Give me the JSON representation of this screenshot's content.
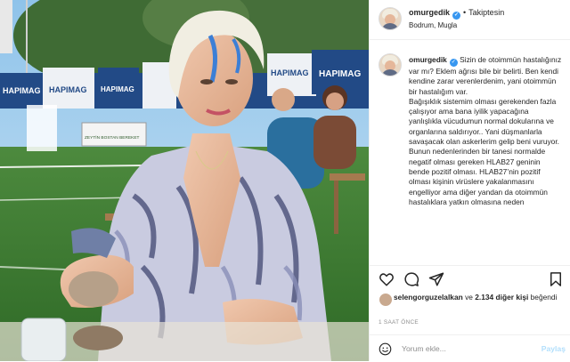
{
  "post": {
    "username": "omurgedik",
    "follow_label": "Takiptesin",
    "location": "Bodrum, Mugla",
    "caption": "Sizin de otoimmün hastalığınız var mı? Eklem ağrısı bile bir belirti. Ben kendi kendine zarar verenlerdenim, yani otoimmün bir hastalığım var.\nBağışıklık sistemim olması gerekenden fazla çalışıyor ama bana iyilik yapacağına yanlışlıkla vücudumun normal dokularına ve organlarına saldırıyor.. Yani düşmanlarla savaşacak olan askerlerim gelip beni vuruyor. Bunun nedenlerinden bir tanesi normalde negatif olması gereken HLAB27 geninin bende pozitif olması. HLAB27’nin pozitif olması kişinin virüslere yakalanmasını engelliyor ama diğer yandan da otoimmün hastalıklara yatkın olmasına neden",
    "liked_by_user": "selengorguzelalkan",
    "liked_joiner": "ve",
    "likes_count": "2.134 diğer kişi",
    "liked_suffix": "beğendi",
    "time_ago": "1 SAAT ÖNCE"
  },
  "photo": {
    "banner_text": "HAPIMAG",
    "sign_text": "ZEYTİN BOSTAN BEREKET"
  },
  "comment_box": {
    "placeholder": "Yorum ekle...",
    "share_label": "Paylaş"
  },
  "icons": {
    "verified": "verified-badge-icon",
    "like": "heart-icon",
    "comment": "comment-bubble-icon",
    "share": "paper-plane-icon",
    "save": "bookmark-icon",
    "emoji": "smiley-icon"
  },
  "colors": {
    "verified_blue": "#3897f0",
    "share_link_disabled": "#b2dffc",
    "muted_text": "#8e8e8e"
  }
}
